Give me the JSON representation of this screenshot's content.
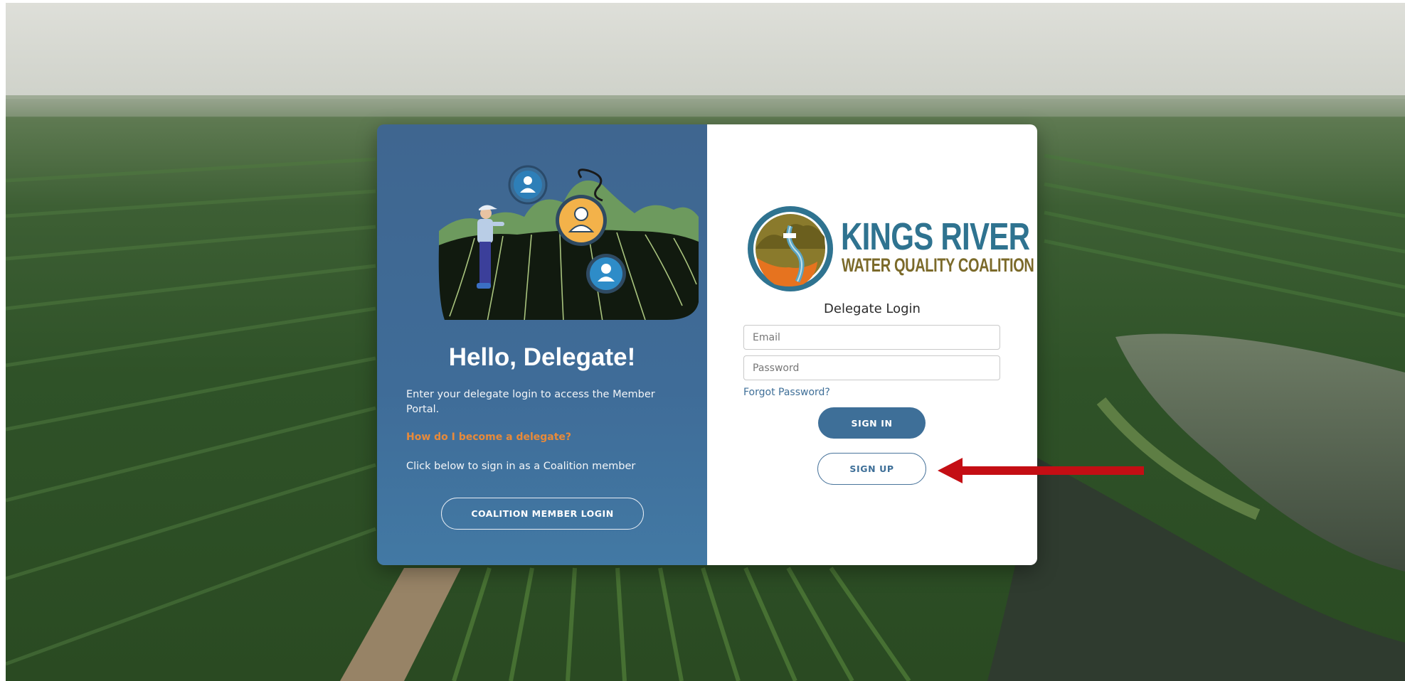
{
  "colors": {
    "left_panel": "#3f6a94",
    "accent_orange": "#e88a3a",
    "button_blue": "#3e6f98",
    "logo_blue": "#2f7390",
    "logo_olive": "#7b6a2a",
    "annotation_arrow": "#c40e14"
  },
  "left": {
    "heading": "Hello, Delegate!",
    "description": "Enter your delegate login to access the Member Portal.",
    "delegate_link": "How do I become a delegate?",
    "click_below": "Click below to sign in as a Coalition member",
    "coalition_button": "COALITION MEMBER LOGIN"
  },
  "logo": {
    "line1": "KINGS RIVER",
    "line2": "WATER QUALITY COALITION"
  },
  "login": {
    "title": "Delegate Login",
    "email_placeholder": "Email",
    "password_placeholder": "Password",
    "forgot": "Forgot Password?",
    "signin": "SIGN IN",
    "signup": "SIGN UP"
  },
  "icons": [
    "user-icon",
    "farmer-illustration",
    "logo-emblem",
    "annotation-arrow"
  ]
}
